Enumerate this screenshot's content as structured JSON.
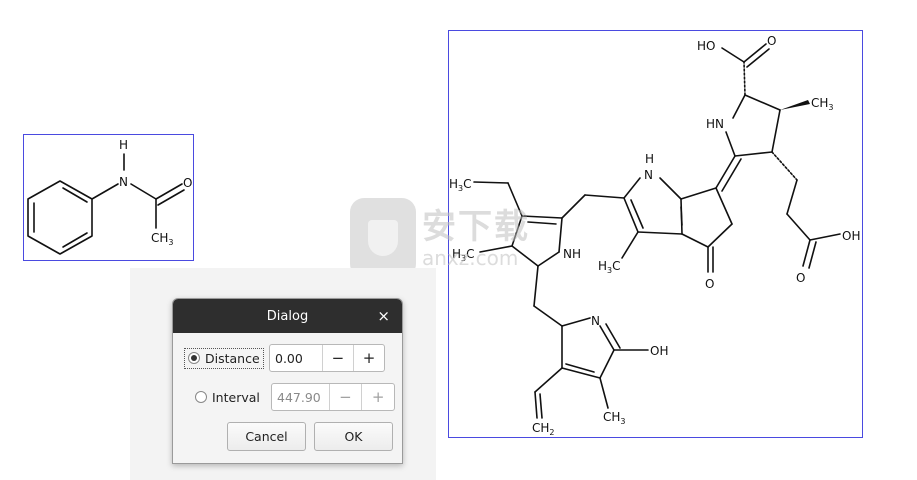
{
  "dialog": {
    "title": "Dialog",
    "close_label": "×",
    "distance": {
      "label": "Distance",
      "value": "0.00",
      "selected": true
    },
    "interval": {
      "label": "Interval",
      "value": "447.90",
      "selected": false
    },
    "minus_label": "−",
    "plus_label": "+",
    "cancel_label": "Cancel",
    "ok_label": "OK"
  },
  "small_molecule": {
    "atoms": {
      "h": "H",
      "n": "N",
      "o": "O",
      "ch3": "CH",
      "ch3_sub": "3"
    }
  },
  "large_molecule": {
    "atoms": {
      "ho_top": "HO",
      "o_top": "O",
      "ch3_top": "CH",
      "ch3_top_sub": "3",
      "hn_right": "HN",
      "nh_mid": "H",
      "n_mid": "N",
      "h3c_left": "H",
      "h3c_left_sub": "3",
      "h3c_left_c": "C",
      "h3c_left2": "H",
      "h3c_left2_sub": "3",
      "h3c_left2_c": "C",
      "nh_left": "NH",
      "h3c_mid": "H",
      "h3c_mid_sub": "3",
      "h3c_mid_c": "C",
      "o_ketone": "O",
      "oh_acid": "OH",
      "o_acid": "O",
      "n_bottom": "N",
      "oh_bottom": "OH",
      "ch2": "CH",
      "ch2_sub": "2",
      "ch3_bottom": "CH",
      "ch3_bottom_sub": "3"
    }
  },
  "watermark": {
    "cn": "安下载",
    "en": "anxz.com"
  }
}
